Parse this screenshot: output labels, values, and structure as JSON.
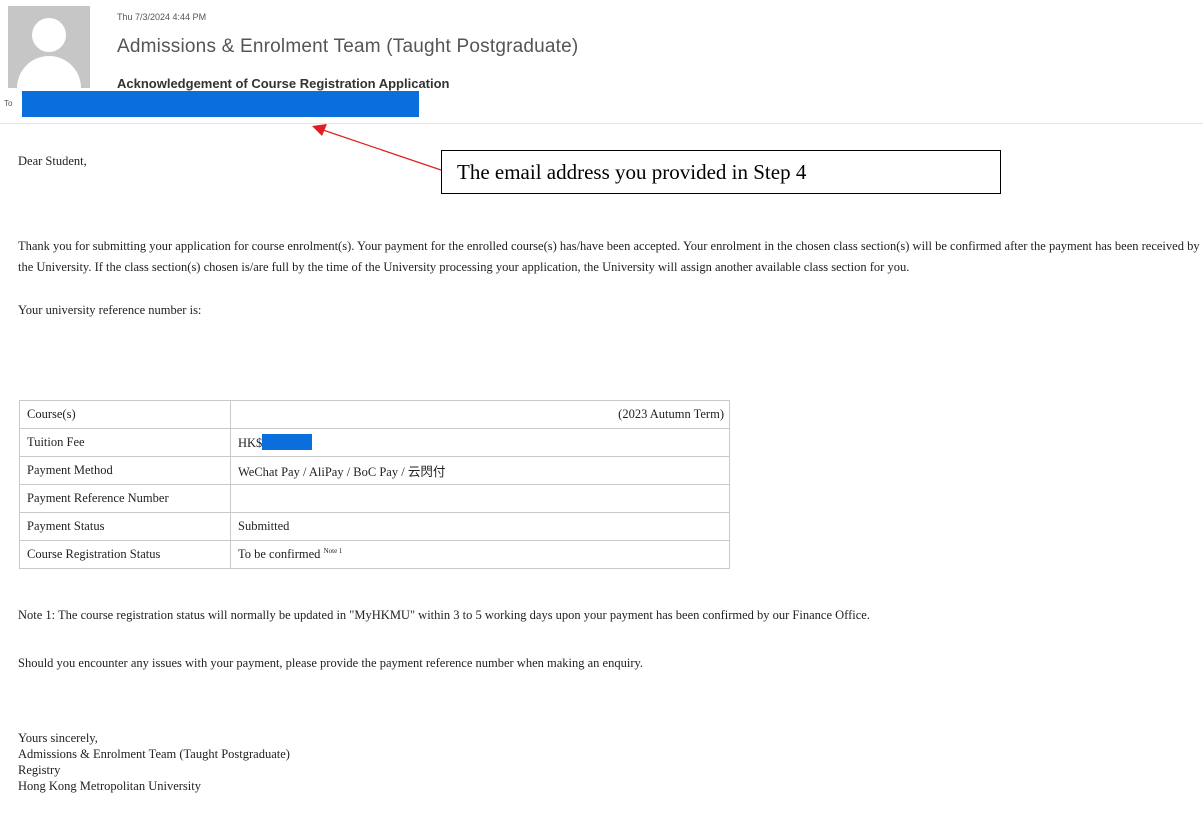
{
  "header": {
    "date": "Thu 7/3/2024 4:44 PM",
    "sender": "Admissions & Enrolment Team (Taught Postgraduate)",
    "subject": "Acknowledgement of Course Registration Application",
    "to_label": "To"
  },
  "callout": {
    "text": "The email address you provided in Step 4",
    "arrow_color": "#e02020"
  },
  "redaction_color": "#0a6fdd",
  "body": {
    "salutation": "Dear Student,",
    "paragraph": "Thank you for submitting your application for course enrolment(s). Your payment for the enrolled course(s) has/have been accepted. Your enrolment in the chosen class section(s) will be confirmed after the payment has been received by the University. If the class section(s) chosen is/are full by the time of the University processing your application, the University will assign another available class section for you.",
    "reference_line": "Your university reference number is:"
  },
  "table": {
    "rows": [
      {
        "label": "Course(s)",
        "value": "(2023 Autumn Term)"
      },
      {
        "label": "Tuition Fee",
        "value": "HK$"
      },
      {
        "label": "Payment Method",
        "value": "WeChat Pay / AliPay / BoC Pay / 云閃付"
      },
      {
        "label": "Payment Reference Number",
        "value": ""
      },
      {
        "label": "Payment Status",
        "value": "Submitted"
      },
      {
        "label": "Course Registration Status",
        "value": "To be confirmed",
        "sup": "Note 1"
      }
    ]
  },
  "note": "Note 1: The course registration status will normally be updated in \"MyHKMU\" within 3 to 5 working days upon your payment has been confirmed by our Finance Office.",
  "enquiry": "Should you encounter any issues with your payment, please provide the payment reference number when making an enquiry.",
  "signature": {
    "closing": "Yours sincerely,",
    "team": "Admissions & Enrolment Team (Taught Postgraduate)",
    "dept": "Registry",
    "university": "Hong Kong Metropolitan University"
  }
}
